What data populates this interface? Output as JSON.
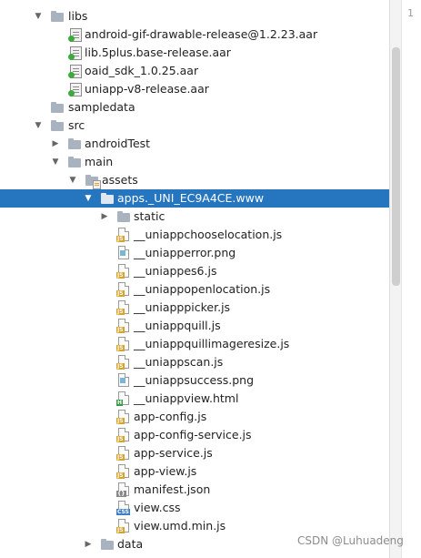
{
  "editor": {
    "line_number": "1"
  },
  "watermark": "CSDN @Luhuadeng",
  "tree": {
    "libs": "libs",
    "lib_files": [
      "android-gif-drawable-release@1.2.23.aar",
      "lib.5plus.base-release.aar",
      "oaid_sdk_1.0.25.aar",
      "uniapp-v8-release.aar"
    ],
    "sampledata": "sampledata",
    "src": "src",
    "androidTest": "androidTest",
    "main": "main",
    "assets": "assets",
    "selected_folder": "apps._UNI_EC9A4CE.www",
    "static": "static",
    "files": [
      {
        "name": "__uniappchooselocation.js",
        "type": "js"
      },
      {
        "name": "__uniapperror.png",
        "type": "png"
      },
      {
        "name": "__uniappes6.js",
        "type": "js"
      },
      {
        "name": "__uniappopenlocation.js",
        "type": "js"
      },
      {
        "name": "__uniapppicker.js",
        "type": "js"
      },
      {
        "name": "__uniappquill.js",
        "type": "js"
      },
      {
        "name": "__uniappquillimageresize.js",
        "type": "js"
      },
      {
        "name": "__uniappscan.js",
        "type": "js"
      },
      {
        "name": "__uniappsuccess.png",
        "type": "png"
      },
      {
        "name": "__uniappview.html",
        "type": "html"
      },
      {
        "name": "app-config.js",
        "type": "js"
      },
      {
        "name": "app-config-service.js",
        "type": "js"
      },
      {
        "name": "app-service.js",
        "type": "js"
      },
      {
        "name": "app-view.js",
        "type": "js"
      },
      {
        "name": "manifest.json",
        "type": "json"
      },
      {
        "name": "view.css",
        "type": "css"
      },
      {
        "name": "view.umd.min.js",
        "type": "js"
      }
    ],
    "data": "data"
  }
}
